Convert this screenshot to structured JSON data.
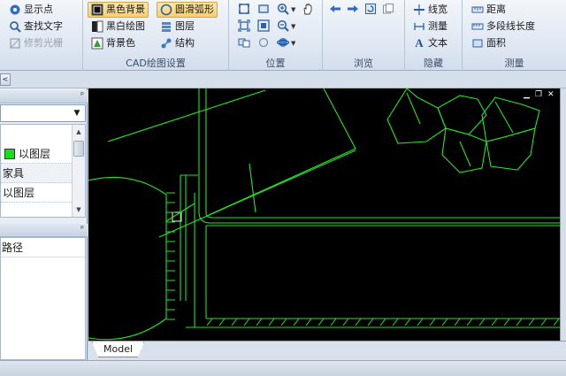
{
  "ribbon": {
    "group0": {
      "items": [
        {
          "label": "显示点",
          "icon": "display-points-icon",
          "disabled": false
        },
        {
          "label": "查找文字",
          "icon": "find-text-icon",
          "disabled": false
        },
        {
          "label": "修剪光栅",
          "icon": "trim-raster-icon",
          "disabled": true
        }
      ]
    },
    "cad_settings": {
      "label": "CAD绘图设置",
      "items": [
        {
          "label": "黑色背景",
          "icon": "black-background-icon",
          "active": true
        },
        {
          "label": "圆滑弧形",
          "icon": "smooth-arc-icon",
          "active": true
        },
        {
          "label": "黑白绘图",
          "icon": "black-white-drawing-icon",
          "active": false
        },
        {
          "label": "图层",
          "icon": "layers-icon",
          "active": false
        },
        {
          "label": "背景色",
          "icon": "background-color-icon",
          "active": false
        },
        {
          "label": "结构",
          "icon": "structure-icon",
          "active": false
        }
      ]
    },
    "position": {
      "label": "位置"
    },
    "browse": {
      "label": "浏览"
    },
    "hide": {
      "label": "隐藏",
      "items": [
        {
          "label": "线宽",
          "icon": "line-width-icon"
        },
        {
          "label": "测量",
          "icon": "measure-icon"
        },
        {
          "label": "文本",
          "icon": "text-icon",
          "glyph": "A"
        }
      ]
    },
    "measure": {
      "label": "测量",
      "items": [
        {
          "label": "距离",
          "icon": "distance-icon"
        },
        {
          "label": "多段线长度",
          "icon": "polyline-length-icon"
        },
        {
          "label": "面积",
          "icon": "area-icon"
        }
      ]
    }
  },
  "strip": {
    "collapse_glyph": "<"
  },
  "left_panel": {
    "pin_glyph": "ᵖ",
    "combo_arrow": "▼",
    "layers": [
      {
        "label": "以图层",
        "swatch": true
      },
      {
        "label": "家具",
        "swatch": false
      },
      {
        "label": "以图层",
        "swatch": false
      }
    ],
    "scroll_up": "▲",
    "scroll_down": "▼",
    "props_rows": [
      "路径"
    ]
  },
  "canvas": {
    "background": "#000000",
    "line_color": "#22e51f",
    "window_controls": {
      "minimize": "▁",
      "restore": "❐",
      "close": "✕"
    }
  },
  "tabs": {
    "model": "Model"
  }
}
